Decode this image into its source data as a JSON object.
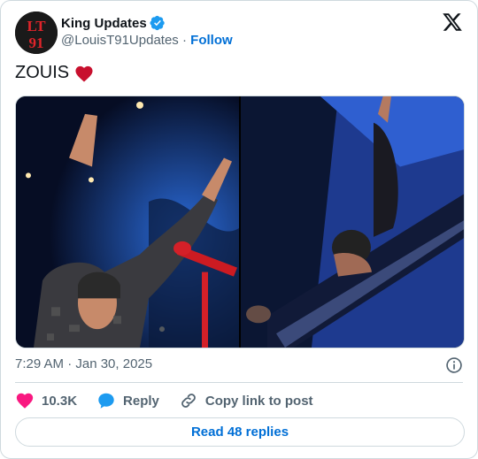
{
  "author": {
    "display_name": "King Updates",
    "handle": "@LouisT91Updates",
    "separator": "·",
    "follow_label": "Follow",
    "avatar_text_top": "LT",
    "avatar_text_bottom": "91",
    "verified": true
  },
  "tweet": {
    "text": "ZOUIS",
    "emoji": "red-heart",
    "timestamp": "7:29 AM · Jan 30, 2025"
  },
  "actions": {
    "like_count": "10.3K",
    "reply_label": "Reply",
    "copy_link_label": "Copy link to post"
  },
  "read_replies_label": "Read 48 replies",
  "colors": {
    "link_blue": "#006fd6",
    "verified_blue": "#1d9bf0",
    "like_pink": "#f91880",
    "reply_blue": "#1d9bf0",
    "secondary_text": "#536471",
    "border": "#cfd9de",
    "avatar_red": "#e0242a"
  },
  "icons": [
    "verified-badge-icon",
    "x-logo-icon",
    "heart-icon",
    "reply-bubble-icon",
    "link-icon",
    "info-icon"
  ]
}
